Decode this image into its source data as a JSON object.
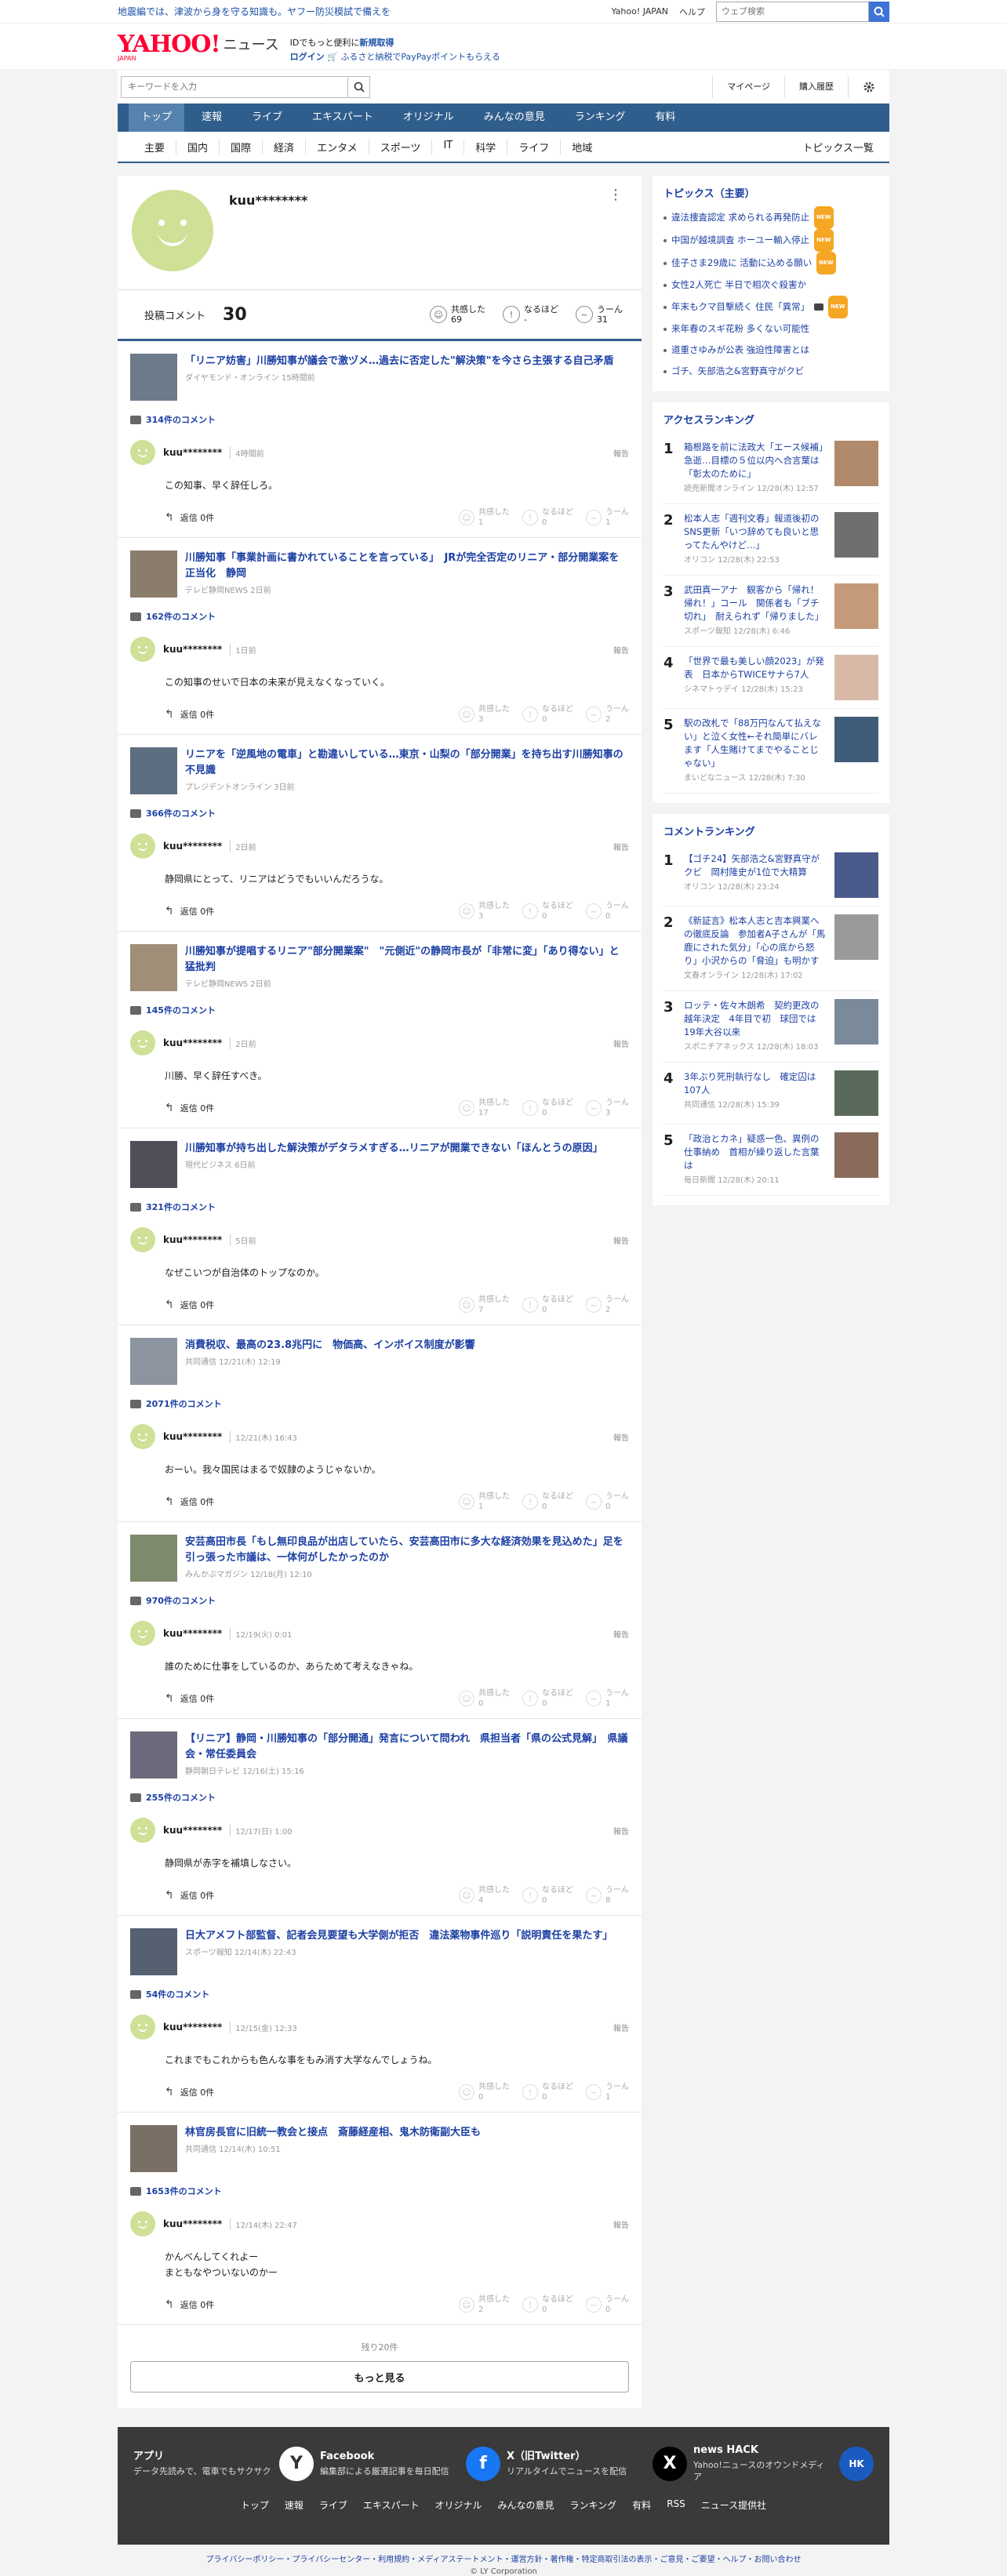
{
  "top": {
    "notice": "地震編では、津波から身を守る知識も。ヤフー防災模試で備えを",
    "yahoo_japan": "Yahoo! JAPAN",
    "help": "ヘルプ",
    "search_placeholder": "ウェブ検索"
  },
  "header": {
    "logo": "YAHOO!",
    "logo_sub": "JAPAN",
    "service": "ニュース",
    "promo1": "IDでもっと便利に",
    "promo1_link": "新規取得",
    "login": "ログイン",
    "promo2": "ふるさと納税でPayPayポイントもらえる"
  },
  "searchbar": {
    "placeholder": "キーワードを入力",
    "mypage": "マイページ",
    "history": "購入履歴"
  },
  "gnav": [
    "トップ",
    "速報",
    "ライブ",
    "エキスパート",
    "オリジナル",
    "みんなの意見",
    "ランキング",
    "有料"
  ],
  "subnav": [
    "主要",
    "国内",
    "国際",
    "経済",
    "エンタメ",
    "スポーツ",
    "IT",
    "科学",
    "ライフ",
    "地域"
  ],
  "subnav_all": "トピックス一覧",
  "profile": {
    "name": "kuu********",
    "posted_label": "投稿コメント",
    "posted_count": "30",
    "empathy_label": "共感した",
    "empathy_count": "69",
    "naruhodo_label": "なるほど",
    "naruhodo_count": "-",
    "uun_label": "うーん",
    "uun_count": "31"
  },
  "labels": {
    "report": "報告",
    "reply": "返信 0件",
    "empathy": "共感した",
    "naruhodo": "なるほど",
    "uun": "うーん"
  },
  "items": [
    {
      "title": "「リニア妨害」川勝知事が議会で激ヅメ…過去に否定した\"解決策\"を今さら主張する自己矛盾",
      "meta": "ダイヤモンド・オンライン 15時間前",
      "comments": "314件のコメント",
      "user": "kuu********",
      "time": "4時間前",
      "body": "この知事、早く辞任しろ。",
      "e": "1",
      "n": "0",
      "u": "1"
    },
    {
      "title": "川勝知事「事業計画に書かれていることを言っている」　JRが完全否定のリニア・部分開業案を正当化　静岡",
      "meta": "テレビ静岡NEWS 2日前",
      "comments": "162件のコメント",
      "user": "kuu********",
      "time": "1日前",
      "body": "この知事のせいで日本の未来が見えなくなっていく。",
      "e": "3",
      "n": "0",
      "u": "2"
    },
    {
      "title": "リニアを「逆風地の電車」と勘違いしている…東京・山梨の「部分開業」を持ち出す川勝知事の不見識",
      "meta": "プレジデントオンライン 3日前",
      "comments": "366件のコメント",
      "user": "kuu********",
      "time": "2日前",
      "body": "静岡県にとって、リニアはどうでもいいんだろうな。",
      "e": "3",
      "n": "0",
      "u": "0"
    },
    {
      "title": "川勝知事が提唱するリニア\"部分開業案\"　\"元側近\"の静岡市長が「非常に変」「あり得ない」と猛批判",
      "meta": "テレビ静岡NEWS 2日前",
      "comments": "145件のコメント",
      "user": "kuu********",
      "time": "2日前",
      "body": "川勝、早く辞任すべき。",
      "e": "17",
      "n": "0",
      "u": "3"
    },
    {
      "title": "川勝知事が持ち出した解決策がデタラメすぎる…リニアが開業できない「ほんとうの原因」",
      "meta": "現代ビジネス 6日前",
      "comments": "321件のコメント",
      "user": "kuu********",
      "time": "5日前",
      "body": "なぜこいつが自治体のトップなのか。",
      "e": "7",
      "n": "0",
      "u": "2"
    },
    {
      "title": "消費税収、最高の23.8兆円に　物価高、インボイス制度が影響",
      "meta": "共同通信 12/21(木) 12:19",
      "comments": "2071件のコメント",
      "user": "kuu********",
      "time": "12/21(木) 16:43",
      "body": "おーい。我々国民はまるで奴隷のようじゃないか。",
      "e": "1",
      "n": "0",
      "u": "0"
    },
    {
      "title": "安芸高田市長「もし無印良品が出店していたら、安芸高田市に多大な経済効果を見込めた」足を引っ張った市議は、一体何がしたかったのか",
      "meta": "みんかぶマガジン 12/18(月) 12:10",
      "comments": "970件のコメント",
      "user": "kuu********",
      "time": "12/19(火) 0:01",
      "body": "誰のために仕事をしているのか、あらためて考えなきゃね。",
      "e": "0",
      "n": "0",
      "u": "1"
    },
    {
      "title": "【リニア】静岡・川勝知事の「部分開通」発言について問われ　県担当者「県の公式見解」　県議会・常任委員会",
      "meta": "静岡朝日テレビ 12/16(土) 15:16",
      "comments": "255件のコメント",
      "user": "kuu********",
      "time": "12/17(日) 1:00",
      "body": "静岡県が赤字を補填しなさい。",
      "e": "4",
      "n": "0",
      "u": "8"
    },
    {
      "title": "日大アメフト部監督、記者会見要望も大学側が拒否　違法薬物事件巡り「説明責任を果たす」",
      "meta": "スポーツ報知 12/14(木) 22:43",
      "comments": "54件のコメント",
      "user": "kuu********",
      "time": "12/15(金) 12:33",
      "body": "これまでもこれからも色んな事をもみ消す大学なんでしょうね。",
      "e": "0",
      "n": "0",
      "u": "1"
    },
    {
      "title": "林官房長官に旧統一教会と接点　斎藤経産相、鬼木防衛副大臣も",
      "meta": "共同通信 12/14(木) 10:51",
      "comments": "1653件のコメント",
      "user": "kuu********",
      "time": "12/14(木) 22:47",
      "body": "かんべんしてくれよー\nまともなやついないのかー",
      "e": "2",
      "n": "0",
      "u": "0"
    }
  ],
  "loadmore": {
    "remaining": "残り20件",
    "button": "もっと見る"
  },
  "topics": {
    "title": "トピックス（主要）",
    "items": [
      "違法捜査認定 求められる再発防止",
      "中国が越境調査 ホーユー輸入停止",
      "佳子さま29歳に 活動に込める願い",
      "女性2人死亡 半日で相次ぐ殺害か",
      "年末もクマ目撃続く 住民「異常」",
      "来年春のスギ花粉 多くない可能性",
      "道重さゆみが公表 強迫性障害とは",
      "ゴチ、矢部浩之&宮野真守がクビ"
    ],
    "new_flags": [
      true,
      true,
      true,
      false,
      true,
      false,
      false,
      false
    ]
  },
  "access_ranking": {
    "title": "アクセスランキング",
    "items": [
      {
        "no": "1",
        "text": "箱根路を前に法政大「エース候補」急逝…目標の５位以内へ合言葉は「彰太のために」",
        "src": "読売新聞オンライン 12/28(木) 12:57"
      },
      {
        "no": "2",
        "text": "松本人志「週刊文春」報道後初のSNS更新「いつ辞めても良いと思ってたんやけど…」",
        "src": "オリコン 12/28(木) 22:53"
      },
      {
        "no": "3",
        "text": "武田真一アナ　観客から「帰れ！帰れ！」コール　関係者も「ブチ切れ」　耐えられず「帰りました」",
        "src": "スポーツ報知 12/28(木) 6:46"
      },
      {
        "no": "4",
        "text": "「世界で最も美しい顔2023」が発表　日本からTWICEサナら7人",
        "src": "シネマトゥデイ 12/28(木) 15:23"
      },
      {
        "no": "5",
        "text": "駅の改札で「88万円なんて払えない」と泣く女性←それ簡単にバレます「人生賭けてまでやることじゃない」",
        "src": "まいどなニュース 12/28(木) 7:30"
      }
    ]
  },
  "comment_ranking": {
    "title": "コメントランキング",
    "items": [
      {
        "no": "1",
        "text": "【ゴチ24】矢部浩之&宮野真守がクビ　岡村隆史が1位で大精算",
        "src": "オリコン 12/28(木) 23:24"
      },
      {
        "no": "2",
        "text": "《新証言》松本人志と吉本興業への徹底反論　参加者A子さんが「馬鹿にされた気分」「心の底から怒り」小沢からの「脅迫」も明かす",
        "src": "文春オンライン 12/28(木) 17:02"
      },
      {
        "no": "3",
        "text": "ロッテ・佐々木朗希　契約更改の越年決定　4年目で初　球団では19年大谷以来",
        "src": "スポニチアネックス 12/28(木) 18:03"
      },
      {
        "no": "4",
        "text": "3年ぶり死刑執行なし　確定囚は107人",
        "src": "共同通信 12/28(木) 15:39"
      },
      {
        "no": "5",
        "text": "「政治とカネ」疑惑一色、異例の仕事納め　首相が繰り返した言葉は",
        "src": "毎日新聞 12/28(木) 20:11"
      }
    ]
  },
  "footer": {
    "apps": [
      {
        "name": "アプリ",
        "desc": "データ先読みで、電車でもサクサク"
      },
      {
        "name": "Facebook",
        "desc": "編集部による厳選記事を毎日配信"
      },
      {
        "name": "X（旧Twitter）",
        "desc": "リアルタイムでニュースを配信"
      },
      {
        "name": "news HACK",
        "desc": "Yahoo!ニュースのオウンドメディア"
      }
    ],
    "nav": [
      "トップ",
      "速報",
      "ライブ",
      "エキスパート",
      "オリジナル",
      "みんなの意見",
      "ランキング",
      "有料",
      "RSS",
      "ニュース提供社"
    ],
    "links": "プライバシーポリシー・プライバシーセンター・利用規約・メディアステートメント・運営方針・著作権・特定商取引法の表示・ご意見・ご要望・ヘルプ・お問い合わせ",
    "copy": "© LY Corporation"
  },
  "colors": {
    "brand": "#ff0033",
    "nav": "#2f5e8c",
    "link": "#1b3fa3",
    "avatar": "#cfe097"
  }
}
